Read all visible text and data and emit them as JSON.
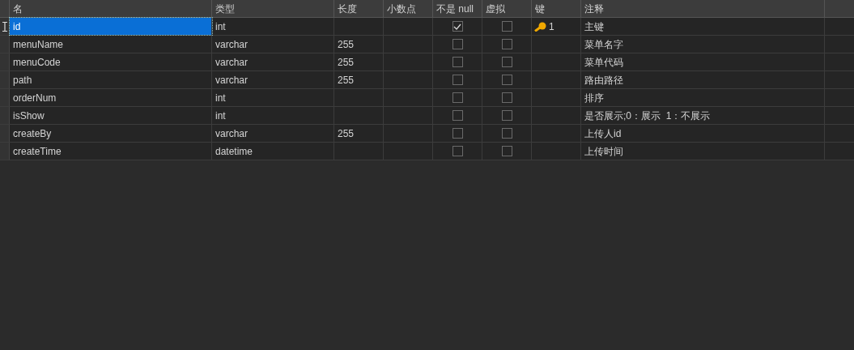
{
  "table": {
    "columns": [
      "名",
      "类型",
      "长度",
      "小数点",
      "不是 null",
      "虚拟",
      "键",
      "注释"
    ],
    "rows": [
      {
        "name": "id",
        "type": "int",
        "length": "",
        "not_null": true,
        "virtual": false,
        "key": "1",
        "comment": "主键",
        "selected": true
      },
      {
        "name": "menuName",
        "type": "varchar",
        "length": "255",
        "not_null": false,
        "virtual": false,
        "comment": "菜单名字",
        "selected": false
      },
      {
        "name": "menuCode",
        "type": "varchar",
        "length": "255",
        "not_null": false,
        "virtual": false,
        "comment": "菜单代码",
        "selected": false
      },
      {
        "name": "path",
        "type": "varchar",
        "length": "255",
        "not_null": false,
        "virtual": false,
        "comment": "路由路径",
        "selected": false
      },
      {
        "name": "orderNum",
        "type": "int",
        "not_null": false,
        "virtual": false,
        "comment": "排序",
        "selected": false
      },
      {
        "name": "isShow",
        "type": "int",
        "not_null": false,
        "virtual": false,
        "comment": "是否展示;0：展示  1：不展示",
        "selected": false
      },
      {
        "name": "createBy",
        "type": "varchar",
        "length": "255",
        "not_null": false,
        "virtual": false,
        "comment": "上传人id",
        "selected": false
      },
      {
        "name": "createTime",
        "type": "datetime",
        "not_null": false,
        "virtual": false,
        "comment": "上传时间",
        "selected": false
      }
    ]
  }
}
